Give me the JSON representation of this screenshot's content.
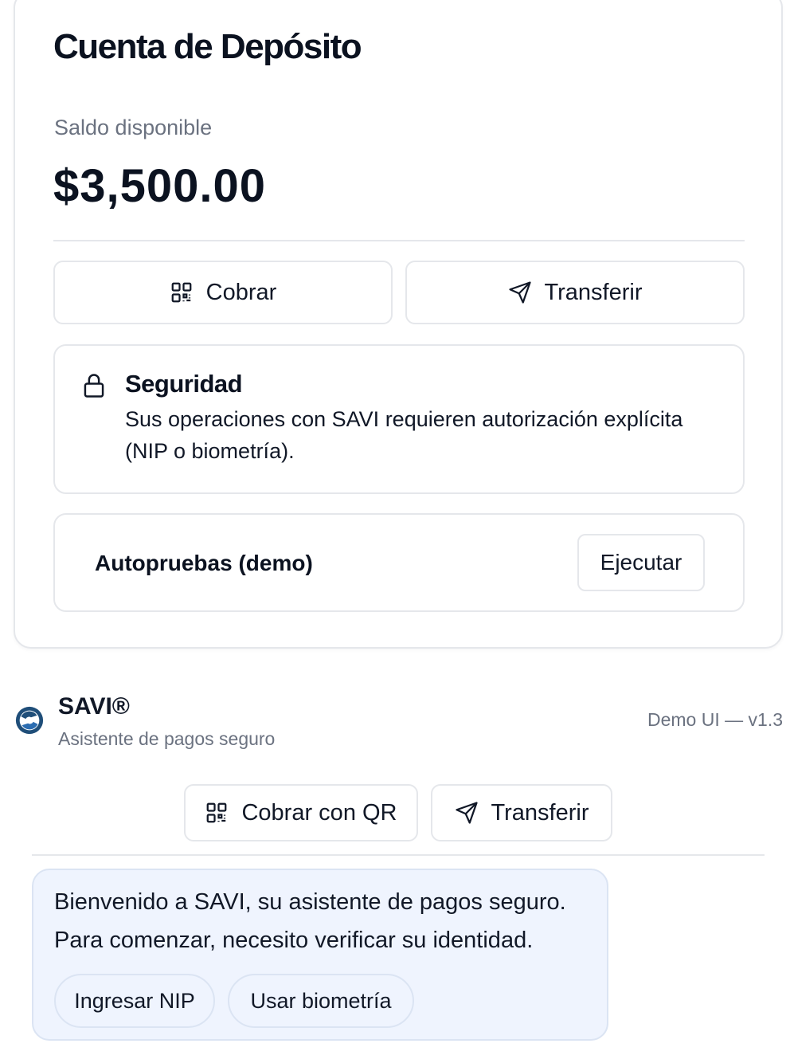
{
  "account": {
    "title": "Cuenta de Depósito",
    "balance_label": "Saldo disponible",
    "balance": "$3,500.00",
    "actions": {
      "cobrar": "Cobrar",
      "transferir": "Transferir"
    },
    "security": {
      "title": "Seguridad",
      "text": "Sus operaciones con SAVI requieren autorización explícita (NIP o biometría)."
    },
    "autotest": {
      "label": "Autopruebas (demo)",
      "run": "Ejecutar"
    }
  },
  "assistant": {
    "name": "SAVI®",
    "subtitle": "Asistente de pagos seguro",
    "version": "Demo UI — v1.3",
    "quick_actions": {
      "qr": "Cobrar con QR",
      "transfer": "Transferir"
    },
    "message": {
      "line1": "Bienvenido a SAVI, su asistente de pagos seguro.",
      "line2": "Para comenzar, necesito verificar su identidad."
    },
    "options": {
      "nip": "Ingresar NIP",
      "biometrics": "Usar biometría"
    }
  },
  "icons": {
    "qr": "qr-code-icon",
    "send": "send-icon",
    "lock": "lock-icon",
    "logo": "savi-logo-icon"
  },
  "colors": {
    "border": "#e5e7eb",
    "muted_text": "#6b7280",
    "bubble_bg": "#eff4fe",
    "logo_blue": "#1f4e79"
  }
}
